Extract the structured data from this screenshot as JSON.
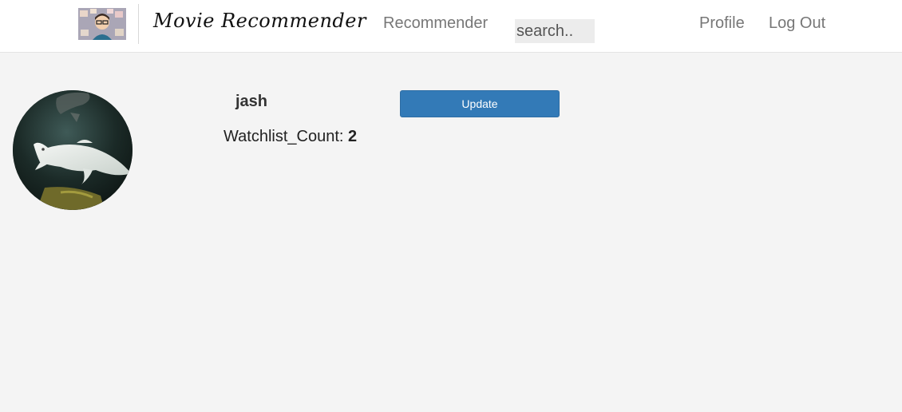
{
  "navbar": {
    "brand": "Movie Recommender",
    "links": {
      "recommender": "Recommender",
      "profile": "Profile",
      "logout": "Log Out"
    },
    "search": {
      "placeholder": "search..",
      "value": ""
    }
  },
  "profile": {
    "username": "jash",
    "watchlist_label": "Watchlist_Count: ",
    "watchlist_count": "2",
    "update_label": "Update"
  },
  "colors": {
    "primary_button": "#337ab7",
    "page_background": "#f4f4f4",
    "navbar_background": "#ffffff",
    "nav_link": "#777777"
  },
  "icons": {
    "logo": "movie-logo-icon",
    "avatar": "profile-avatar-image"
  }
}
